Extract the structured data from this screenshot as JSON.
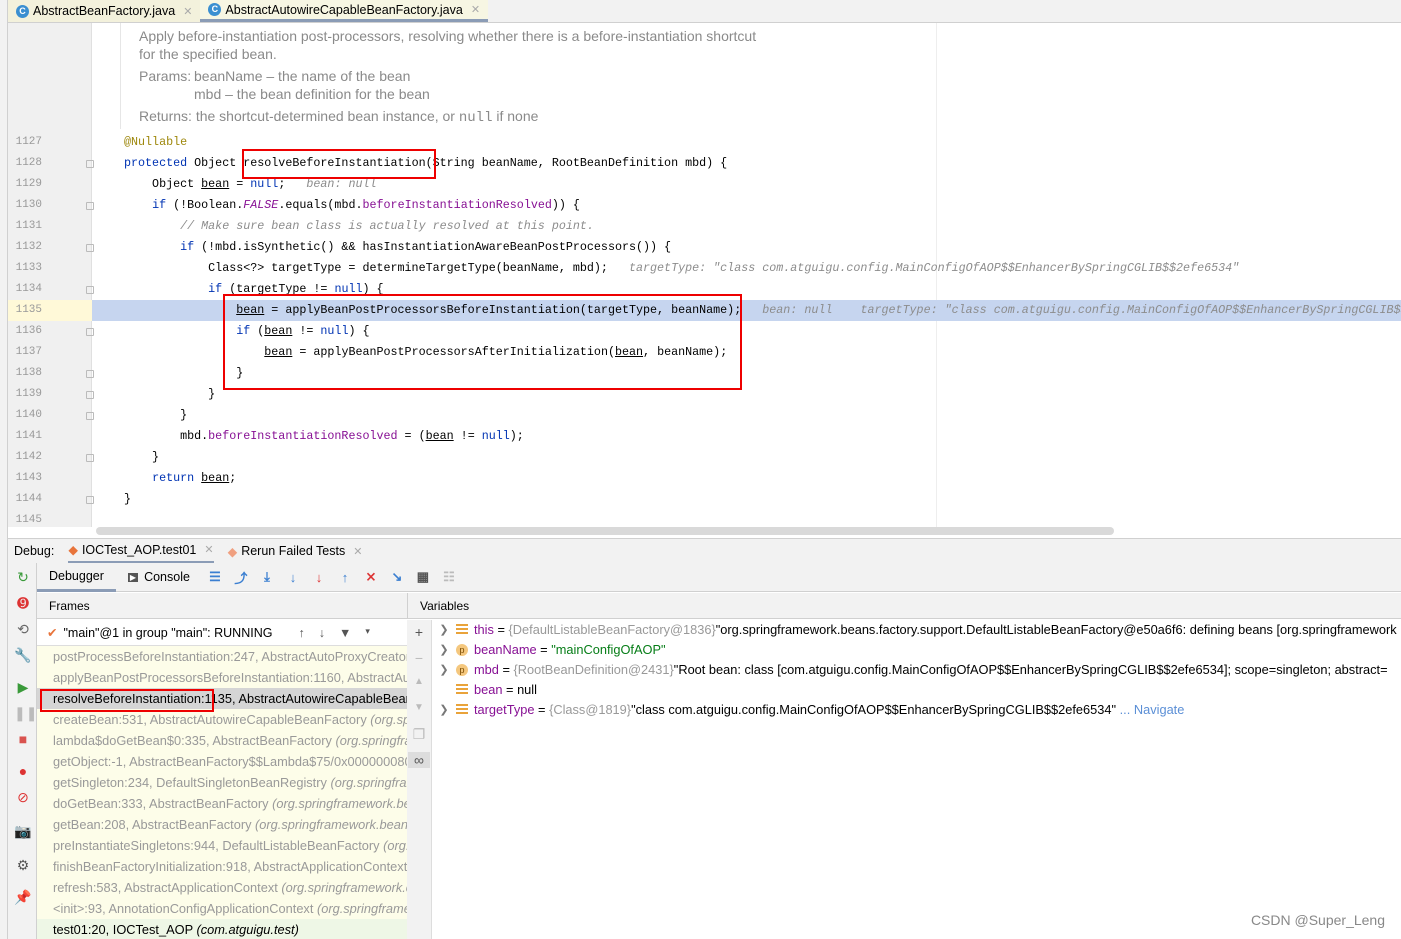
{
  "tabs": [
    {
      "label": "AbstractBeanFactory.java",
      "icon": "class-icon"
    },
    {
      "label": "AbstractAutowireCapableBeanFactory.java",
      "icon": "class-icon",
      "active": true
    }
  ],
  "doc": {
    "summary1": "Apply before-instantiation post-processors, resolving whether there is a before-instantiation shortcut",
    "summary2": "for the specified bean.",
    "params_label": "Params:",
    "param1": "beanName – the name of the bean",
    "param2": "mbd – the bean definition for the bean",
    "returns_label": "Returns:",
    "returns_pre": "the shortcut-determined bean instance, or ",
    "returns_code": "null",
    "returns_post": " if none"
  },
  "code": [
    {
      "n": "1127",
      "s": [
        [
          "@Nullable",
          "a"
        ]
      ]
    },
    {
      "n": "1128",
      "s": [
        [
          "protected ",
          "k"
        ],
        [
          "Object resolveBeforeInstantiation(String beanName, RootBeanDefinition mbd) {",
          ""
        ]
      ]
    },
    {
      "n": "1129",
      "s": [
        [
          "    Object ",
          ""
        ],
        [
          "bean",
          "u"
        ],
        [
          " = ",
          ""
        ],
        [
          "null",
          "k"
        ],
        [
          ";   ",
          ""
        ],
        [
          "bean: null",
          "h"
        ]
      ]
    },
    {
      "n": "1130",
      "s": [
        [
          "    ",
          ""
        ],
        [
          "if ",
          "k"
        ],
        [
          "(!Boolean.",
          ""
        ],
        [
          "FALSE",
          "i"
        ],
        [
          ".equals(mbd.",
          ""
        ],
        [
          "beforeInstantiationResolved",
          "f"
        ],
        [
          ")) {",
          ""
        ]
      ]
    },
    {
      "n": "1131",
      "s": [
        [
          "        ",
          ""
        ],
        [
          "// Make sure bean class is actually resolved at this point.",
          "c"
        ]
      ]
    },
    {
      "n": "1132",
      "s": [
        [
          "        ",
          ""
        ],
        [
          "if ",
          "k"
        ],
        [
          "(!mbd.isSynthetic() && hasInstantiationAwareBeanPostProcessors()) {",
          ""
        ]
      ]
    },
    {
      "n": "1133",
      "s": [
        [
          "            Class<?> targetType = determineTargetType(beanName, mbd);   ",
          ""
        ],
        [
          "targetType: \"class com.atguigu.config.MainConfigOfAOP$$EnhancerBySpringCGLIB$$2efe6534\"",
          "h"
        ]
      ]
    },
    {
      "n": "1134",
      "s": [
        [
          "            ",
          ""
        ],
        [
          "if ",
          "k"
        ],
        [
          "(targetType != ",
          ""
        ],
        [
          "null",
          "k"
        ],
        [
          ") {",
          ""
        ]
      ]
    },
    {
      "n": "1135",
      "s": [
        [
          "                ",
          ""
        ],
        [
          "bean",
          "u"
        ],
        [
          " = applyBeanPostProcessorsBeforeInstantiation(targetType, beanName);   ",
          ""
        ],
        [
          "bean: null    targetType: \"class com.atguigu.config.MainConfigOfAOP$$EnhancerBySpringCGLIB$$",
          "h"
        ]
      ]
    },
    {
      "n": "1136",
      "s": [
        [
          "                ",
          ""
        ],
        [
          "if ",
          "k"
        ],
        [
          "(",
          ""
        ],
        [
          "bean",
          "u"
        ],
        [
          " != ",
          ""
        ],
        [
          "null",
          "k"
        ],
        [
          ") {",
          ""
        ]
      ]
    },
    {
      "n": "1137",
      "s": [
        [
          "                    ",
          ""
        ],
        [
          "bean",
          "u"
        ],
        [
          " = applyBeanPostProcessorsAfterInitialization(",
          ""
        ],
        [
          "bean",
          "u"
        ],
        [
          ", beanName);",
          ""
        ]
      ]
    },
    {
      "n": "1138",
      "s": [
        [
          "                }",
          ""
        ]
      ]
    },
    {
      "n": "1139",
      "s": [
        [
          "            }",
          ""
        ]
      ]
    },
    {
      "n": "1140",
      "s": [
        [
          "        }",
          ""
        ]
      ]
    },
    {
      "n": "1141",
      "s": [
        [
          "        mbd.",
          ""
        ],
        [
          "beforeInstantiationResolved",
          "f"
        ],
        [
          " = (",
          ""
        ],
        [
          "bean",
          "u"
        ],
        [
          " != ",
          ""
        ],
        [
          "null",
          "k"
        ],
        [
          ");",
          ""
        ]
      ]
    },
    {
      "n": "1142",
      "s": [
        [
          "    }",
          ""
        ]
      ]
    },
    {
      "n": "1143",
      "s": [
        [
          "    ",
          ""
        ],
        [
          "return ",
          "k"
        ],
        [
          "bean",
          "u"
        ],
        [
          ";",
          ""
        ]
      ]
    },
    {
      "n": "1144",
      "s": [
        [
          "}",
          ""
        ]
      ]
    },
    {
      "n": "1145",
      "s": []
    }
  ],
  "debug": {
    "label": "Debug:",
    "tabs": [
      {
        "label": "IOCTest_AOP.test01"
      },
      {
        "label": "Rerun Failed Tests"
      }
    ],
    "toolbar": {
      "debugger": "Debugger",
      "console": "Console"
    },
    "frames_title": "Frames",
    "variables_title": "Variables",
    "thread": "\"main\"@1 in group \"main\": RUNNING",
    "frames": [
      {
        "m": "postProcessBeforeInstantiation:247, AbstractAutoProxyCreator",
        "p": ""
      },
      {
        "m": "applyBeanPostProcessorsBeforeInstantiation:1160, AbstractAutowireCapableBeanFactory",
        "p": ""
      },
      {
        "m": "resolveBeforeInstantiation:1135, AbstractAutowireCapableBeanFactory",
        "p": "",
        "selected": true
      },
      {
        "m": "createBean:531, AbstractAutowireCapableBeanFactory ",
        "p": "(org.springframework.beans.factory.support)"
      },
      {
        "m": "lambda$doGetBean$0:335, AbstractBeanFactory ",
        "p": "(org.springframework.beans.factory.support)"
      },
      {
        "m": "getObject:-1, AbstractBeanFactory$$Lambda$75/0x0000000800",
        "p": ""
      },
      {
        "m": "getSingleton:234, DefaultSingletonBeanRegistry ",
        "p": "(org.springframework.beans.factory.support)"
      },
      {
        "m": "doGetBean:333, AbstractBeanFactory ",
        "p": "(org.springframework.beans.factory.support)"
      },
      {
        "m": "getBean:208, AbstractBeanFactory ",
        "p": "(org.springframework.beans.factory.support)"
      },
      {
        "m": "preInstantiateSingletons:944, DefaultListableBeanFactory ",
        "p": "(org.springframework.beans.factory.support)"
      },
      {
        "m": "finishBeanFactoryInitialization:918, AbstractApplicationContext ",
        "p": "(org.springframework.context.support)"
      },
      {
        "m": "refresh:583, AbstractApplicationContext ",
        "p": "(org.springframework.context.support)"
      },
      {
        "m": "<init>:93, AnnotationConfigApplicationContext ",
        "p": "(org.springframework.context.annotation)"
      },
      {
        "m": "test01:20, IOCTest_AOP ",
        "p": "(com.atguigu.test)",
        "current": true
      }
    ],
    "variables": [
      {
        "name": "this",
        "type": "{DefaultListableBeanFactory@1836}",
        "value": " \"org.springframework.beans.factory.support.DefaultListableBeanFactory@e50a6f6: defining beans [org.springframework",
        "icon": "field",
        "expand": true
      },
      {
        "name": "beanName",
        "type": "",
        "value": "\"mainConfigOfAOP\"",
        "icon": "param",
        "expand": true,
        "str": true
      },
      {
        "name": "mbd",
        "type": "{RootBeanDefinition@2431}",
        "value": " \"Root bean: class [com.atguigu.config.MainConfigOfAOP$$EnhancerBySpringCGLIB$$2efe6534]; scope=singleton; abstract=",
        "icon": "param",
        "expand": true
      },
      {
        "name": "bean",
        "type": "",
        "value": "null",
        "icon": "field",
        "expand": false
      },
      {
        "name": "targetType",
        "type": "{Class@1819}",
        "value": " \"class com.atguigu.config.MainConfigOfAOP$$EnhancerBySpringCGLIB$$2efe6534\"",
        "icon": "field",
        "expand": true,
        "nav": "... Navigate"
      }
    ]
  },
  "watermark": "CSDN @Super_Leng",
  "colors": {
    "highlight_line": "#c6d5ef",
    "annotation_box": "#e00000",
    "keyword": "#0033b3",
    "field": "#871094"
  }
}
